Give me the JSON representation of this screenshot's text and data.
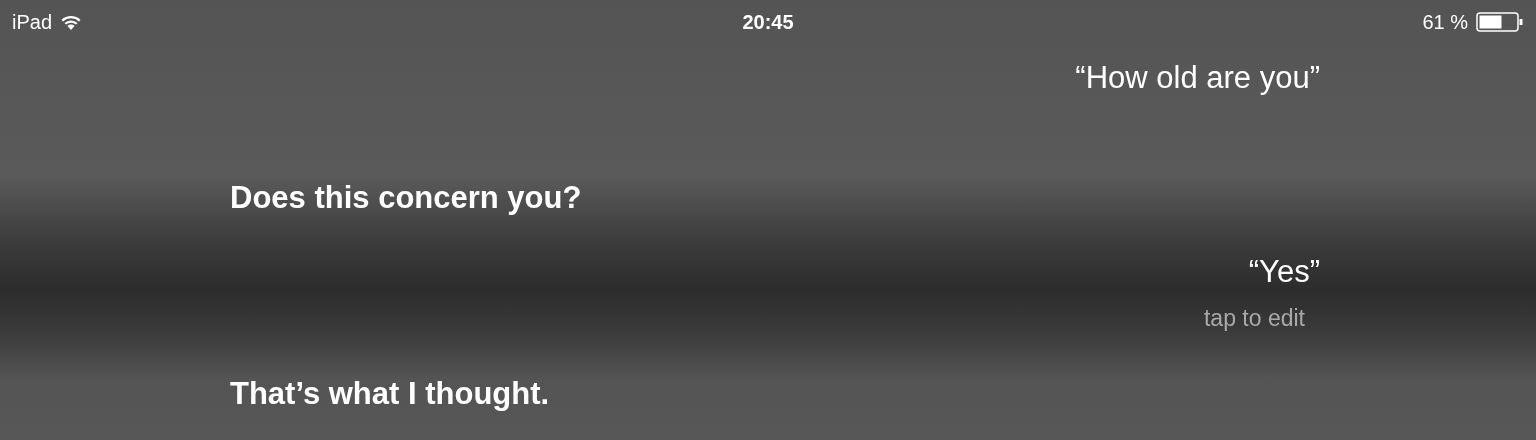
{
  "status_bar": {
    "carrier": "iPad",
    "time": "20:45",
    "battery": "61 %"
  },
  "conversation": [
    {
      "kind": "user",
      "text": "“How old are you”"
    },
    {
      "kind": "siri",
      "text": "Does this concern you?"
    },
    {
      "kind": "user",
      "text": "“Yes”",
      "hint": "tap to edit"
    },
    {
      "kind": "siri",
      "text": "That’s what I thought."
    }
  ]
}
